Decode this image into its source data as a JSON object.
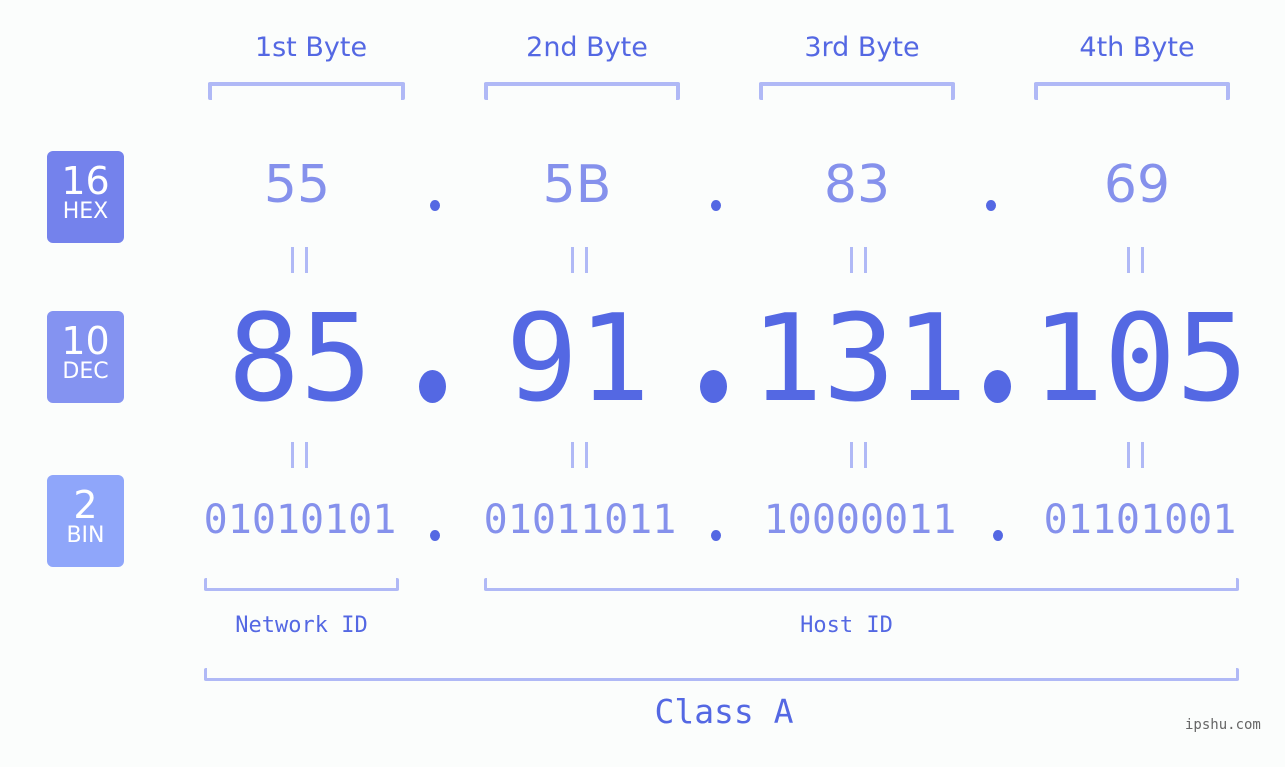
{
  "bytes": [
    {
      "header": "1st Byte",
      "hex": "55",
      "dec": "85",
      "bin": "01010101"
    },
    {
      "header": "2nd Byte",
      "hex": "5B",
      "dec": "91",
      "bin": "01011011"
    },
    {
      "header": "3rd Byte",
      "hex": "83",
      "dec": "131",
      "bin": "10000011"
    },
    {
      "header": "4th Byte",
      "hex": "69",
      "dec": "105",
      "bin": "01101001"
    }
  ],
  "separator": ".",
  "badges": {
    "hex": {
      "number": "16",
      "label": "HEX",
      "color": "#7482ec"
    },
    "dec": {
      "number": "10",
      "label": "DEC",
      "color": "#8493f1"
    },
    "bin": {
      "number": "2",
      "label": "BIN",
      "color": "#8fa6fa"
    }
  },
  "network_id_label": "Network ID",
  "host_id_label": "Host ID",
  "class_label": "Class A",
  "watermark": "ipshu.com",
  "colors": {
    "accent": "#5468e3",
    "light": "#8591ec",
    "bracket": "#b0b9f6",
    "background": "#fbfdfc"
  }
}
